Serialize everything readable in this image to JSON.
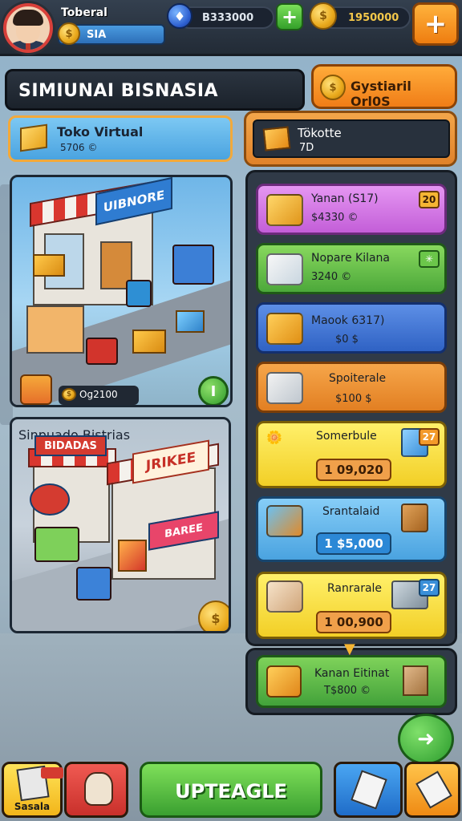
{
  "header": {
    "player_name": "Toberal",
    "level_value": "SIA",
    "gems_value": "B333000",
    "coins_value": "1950000"
  },
  "title_banner": "SIMIUNAI BISNASIA",
  "orange_button_label": "Gystiaril Orl0S",
  "store_left": {
    "name": "Toko Virtual",
    "sub": "5706 ©"
  },
  "store_right": {
    "name": "Tökotte",
    "sub": "7D"
  },
  "scene1": {
    "sign": "UIBNORE",
    "tag": "Og2100",
    "round_label": "I"
  },
  "scene2": {
    "label": "Sinpuado Bistrias",
    "sign_left": "BIDADAS",
    "sign_right": "JRIKEE",
    "sign_small": "BAREE"
  },
  "items": [
    {
      "name": "Yanan (S17)",
      "price": "$4330 ©",
      "badge": "20",
      "color": "purple"
    },
    {
      "name": "Nopare Kilana",
      "price": "3240 ©",
      "badge": "✳",
      "color": "green"
    },
    {
      "name": "Maook 6317)",
      "price": "$0 $",
      "badge": "",
      "color": "blue"
    },
    {
      "name": "Spoiterale",
      "price": "$100 $",
      "badge": "",
      "color": "orange"
    },
    {
      "name": "Somerbule",
      "price": "1 09,020",
      "badge": "27",
      "color": "yellow"
    },
    {
      "name": "Srantalaid",
      "price": "1 $5,000",
      "badge": "",
      "color": "lightblue"
    },
    {
      "name": "Ranrarale",
      "price": "1 00,900",
      "badge": "27",
      "color": "yellow"
    }
  ],
  "bottom_item": {
    "name": "Kanan Eitinat",
    "price": "T$800 ©"
  },
  "nav": {
    "left_label": "Sasala",
    "upgrade_label": "UPTEAGLE"
  }
}
